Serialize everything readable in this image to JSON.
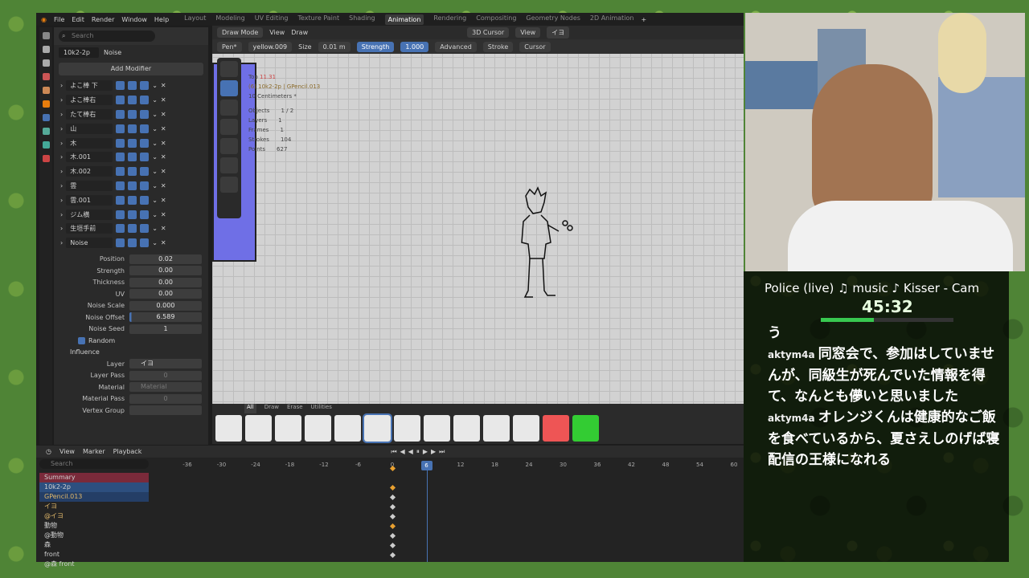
{
  "menu": {
    "file": "File",
    "edit": "Edit",
    "render": "Render",
    "window": "Window",
    "help": "Help"
  },
  "workspaces": [
    "Layout",
    "Modeling",
    "UV Editing",
    "Texture Paint",
    "Shading",
    "Animation",
    "Rendering",
    "Compositing",
    "Geometry Nodes",
    "2D Animation"
  ],
  "active_workspace": "Animation",
  "props": {
    "search_placeholder": "Search",
    "object_name": "10k2-2p",
    "modifier_type": "Noise",
    "add_modifier": "Add Modifier",
    "modifiers": [
      "よこ棒 下",
      "よこ棒右",
      "たて棒右",
      "山",
      "木",
      "木.001",
      "木.002",
      "雲",
      "雲.001",
      "ジム横",
      "生垣手前",
      "Noise"
    ],
    "fields": [
      {
        "label": "Position",
        "value": "0.02"
      },
      {
        "label": "Strength",
        "value": "0.00"
      },
      {
        "label": "Thickness",
        "value": "0.00"
      },
      {
        "label": "UV",
        "value": "0.00"
      },
      {
        "label": "Noise Scale",
        "value": "0.000"
      },
      {
        "label": "Noise Offset",
        "value": "6.589"
      },
      {
        "label": "Noise Seed",
        "value": "1"
      }
    ],
    "random": "Random",
    "influence": "Influence",
    "layer_label": "Layer",
    "layer_value": "イヨ",
    "layer_pass": "Layer Pass",
    "layer_pass_value": "0",
    "material_label": "Material",
    "material_value": "Material",
    "material_pass": "Material Pass",
    "material_pass_value": "0",
    "vertex_group": "Vertex Group"
  },
  "viewport": {
    "mode": "Draw Mode",
    "view": "View",
    "draw": "Draw",
    "cursor": "3D Cursor",
    "view2": "View",
    "layer": "イヨ",
    "brush": "Pen*",
    "material": "yellow.009",
    "size_label": "Size",
    "size_value": "0.01 m",
    "strength_label": "Strength",
    "strength_value": "1.000",
    "advanced": "Advanced",
    "stroke": "Stroke",
    "cursor2": "Cursor",
    "stats_title": "Top",
    "stats_frame": "11.31",
    "stats_object": "(6) 10k2-2p | GPencil.013",
    "stats_units": "10 Centimeters *",
    "stats": [
      [
        "Objects",
        "1 / 2"
      ],
      [
        "Layers",
        "1"
      ],
      [
        "Frames",
        "1"
      ],
      [
        "Strokes",
        "104"
      ],
      [
        "Points",
        "627"
      ]
    ]
  },
  "brush_tabs": [
    "All",
    "Draw",
    "Erase",
    "Utilities"
  ],
  "timeline": {
    "view": "View",
    "marker": "Marker",
    "playback": "Playback",
    "search_placeholder": "Search",
    "current_frame": "6",
    "ticks": [
      "-36",
      "-30",
      "-24",
      "-18",
      "-12",
      "-6",
      "0",
      "6",
      "12",
      "18",
      "24",
      "30",
      "36",
      "42",
      "48",
      "54",
      "60"
    ],
    "channels": [
      "Summary",
      "10k2-2p",
      "GPencil.013",
      "イヨ",
      "@イヨ",
      "動物",
      "@動物",
      "森",
      "front",
      "@森 front"
    ]
  },
  "stream": {
    "now_playing": "Police (live)   ♫ music ♪ Kisser - Cam",
    "timer": "45:32",
    "timer_progress": 0.4,
    "chat": [
      {
        "user": "",
        "text": "う"
      },
      {
        "user": "aktym4a",
        "text": "同窓会で、参加はしていませんが、同級生が死んでいた情報を得て、なんとも儚いと思いました"
      },
      {
        "user": "aktym4a",
        "text": "オレンジくんは健康的なご飯を食べているから、夏さえしのげば寝配信の王様になれる"
      }
    ]
  }
}
